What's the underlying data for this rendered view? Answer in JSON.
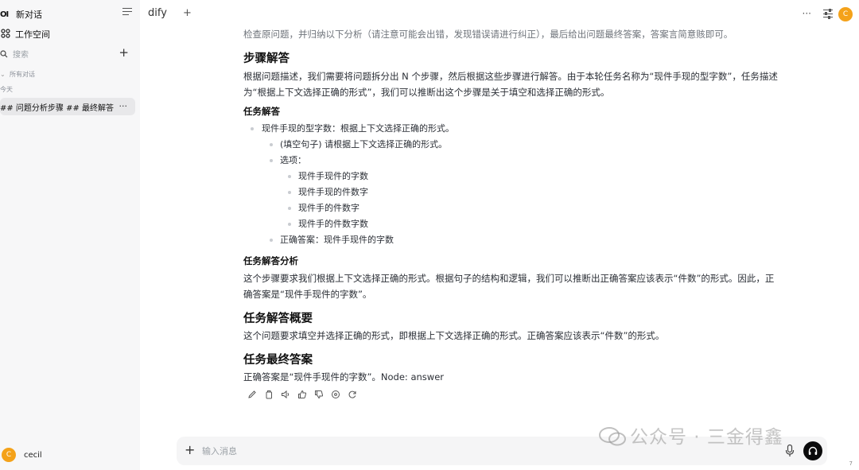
{
  "sidebar": {
    "logo": "OI",
    "new_chat": "新对话",
    "workspace": "工作空间",
    "search_placeholder": "搜索",
    "section": "所有对话",
    "group_today": "今天",
    "chat_item": "## 问题分析步骤 ## 最终解答",
    "more": "···",
    "user_name": "cecil",
    "user_initial": "C"
  },
  "header": {
    "app_name": "dify",
    "tab_add": "+",
    "more": "···",
    "avatar_initial": "C"
  },
  "message": {
    "intro": "检查原问题，并归纳以下分析（请注意可能会出错，发现错误请进行纠正），最后给出问题最终答案，答案言简意赅即可。",
    "h_steps": "步骤解答",
    "steps_p1": "根据问题描述，我们需要将问题拆分出 N 个步骤，然后根据这些步骤进行解答。由于本轮任务名称为“现件手现的型字数”，任务描述",
    "steps_p2": "为“根据上下文选择正确的形式”，我们可以推断出这个步骤是关于填空和选择正确的形式。",
    "h_task": "任务解答",
    "li1": "现件手现的型字数：根据上下文选择正确的形式。",
    "li1_1": "(填空句子) 请根据上下文选择正确的形式。",
    "li1_2": "选项：",
    "opt1": "现件手现件的字数",
    "opt2": "现件手现的件数字",
    "opt3": "现件手的件数字",
    "opt4": "现件手的件数字数",
    "li1_3": "正确答案：现件手现件的字数",
    "h_analysis": "任务解答分析",
    "analysis_p1": "这个步骤要求我们根据上下文选择正确的形式。根据句子的结构和逻辑，我们可以推断出正确答案应该表示“件数”的形式。因此，正",
    "analysis_p2": "确答案是“现件手现件的字数”。",
    "h_summary": "任务解答概要",
    "summary_p": "这个问题要求填空并选择正确的形式，即根据上下文选择正确的形式。正确答案应该表示“件数”的形式。",
    "h_final": "任务最终答案",
    "final_p": "正确答案是“现件手现件的字数”。Node: answer"
  },
  "actions": [
    "edit-icon",
    "copy-icon",
    "speaker-icon",
    "thumbs-up-icon",
    "thumbs-down-icon",
    "info-icon",
    "regenerate-icon"
  ],
  "input": {
    "placeholder": "输入消息",
    "plus": "+"
  },
  "watermark": "公众号 · 三金得鑫",
  "page_num": "7",
  "colors": {
    "accent": "#f4a21a",
    "sidebar_bg": "#f7f7f8",
    "selected_bg": "#e8e8ea",
    "send_bg": "#0b0b0c"
  }
}
